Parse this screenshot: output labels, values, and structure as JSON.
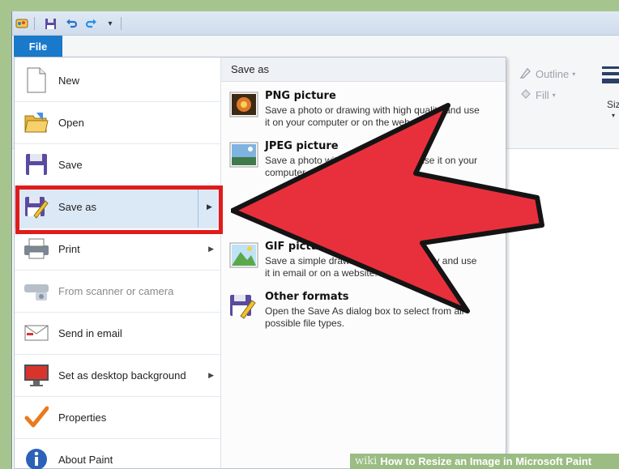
{
  "app": {
    "file_tab": "File",
    "qat_icons": [
      "paint-app-icon",
      "save-icon",
      "undo-icon",
      "redo-icon",
      "customize-dropdown-icon"
    ]
  },
  "ribbon": {
    "outline": "Outline",
    "fill": "Fill",
    "size": "Siz"
  },
  "menu": {
    "items": [
      {
        "label": "New",
        "icon": "new-document-icon"
      },
      {
        "label": "Open",
        "icon": "open-folder-icon"
      },
      {
        "label": "Save",
        "icon": "save-floppy-icon"
      },
      {
        "label": "Save as",
        "icon": "save-as-icon",
        "selected": true
      },
      {
        "label": "Print",
        "icon": "printer-icon"
      },
      {
        "label": "From scanner or camera",
        "icon": "scanner-icon",
        "disabled": true
      },
      {
        "label": "Send in email",
        "icon": "email-icon"
      },
      {
        "label": "Set as desktop background",
        "icon": "desktop-background-icon"
      },
      {
        "label": "Properties",
        "icon": "checkmark-icon"
      },
      {
        "label": "About Paint",
        "icon": "info-icon"
      }
    ]
  },
  "save_as": {
    "header": "Save as",
    "options": [
      {
        "title": "PNG picture",
        "desc": "Save a photo or drawing with high quality and use it on your computer or on the web."
      },
      {
        "title": "JPEG picture",
        "desc": "Save a photo with good quality and use it on your computer or on the web."
      },
      {
        "title": "GIF picture",
        "desc": "Save a simple drawing with lower quality and use it in email or on a website."
      },
      {
        "title": "Other formats",
        "desc": "Open the Save As dialog box to select from all possible file types."
      }
    ]
  },
  "colors": {
    "accent": "#1979ca",
    "highlight": "#e01b1b",
    "arrow_fill": "#e8303c"
  },
  "watermark": {
    "brand": "wiki",
    "text": "How to Resize an Image in Microsoft Paint"
  }
}
